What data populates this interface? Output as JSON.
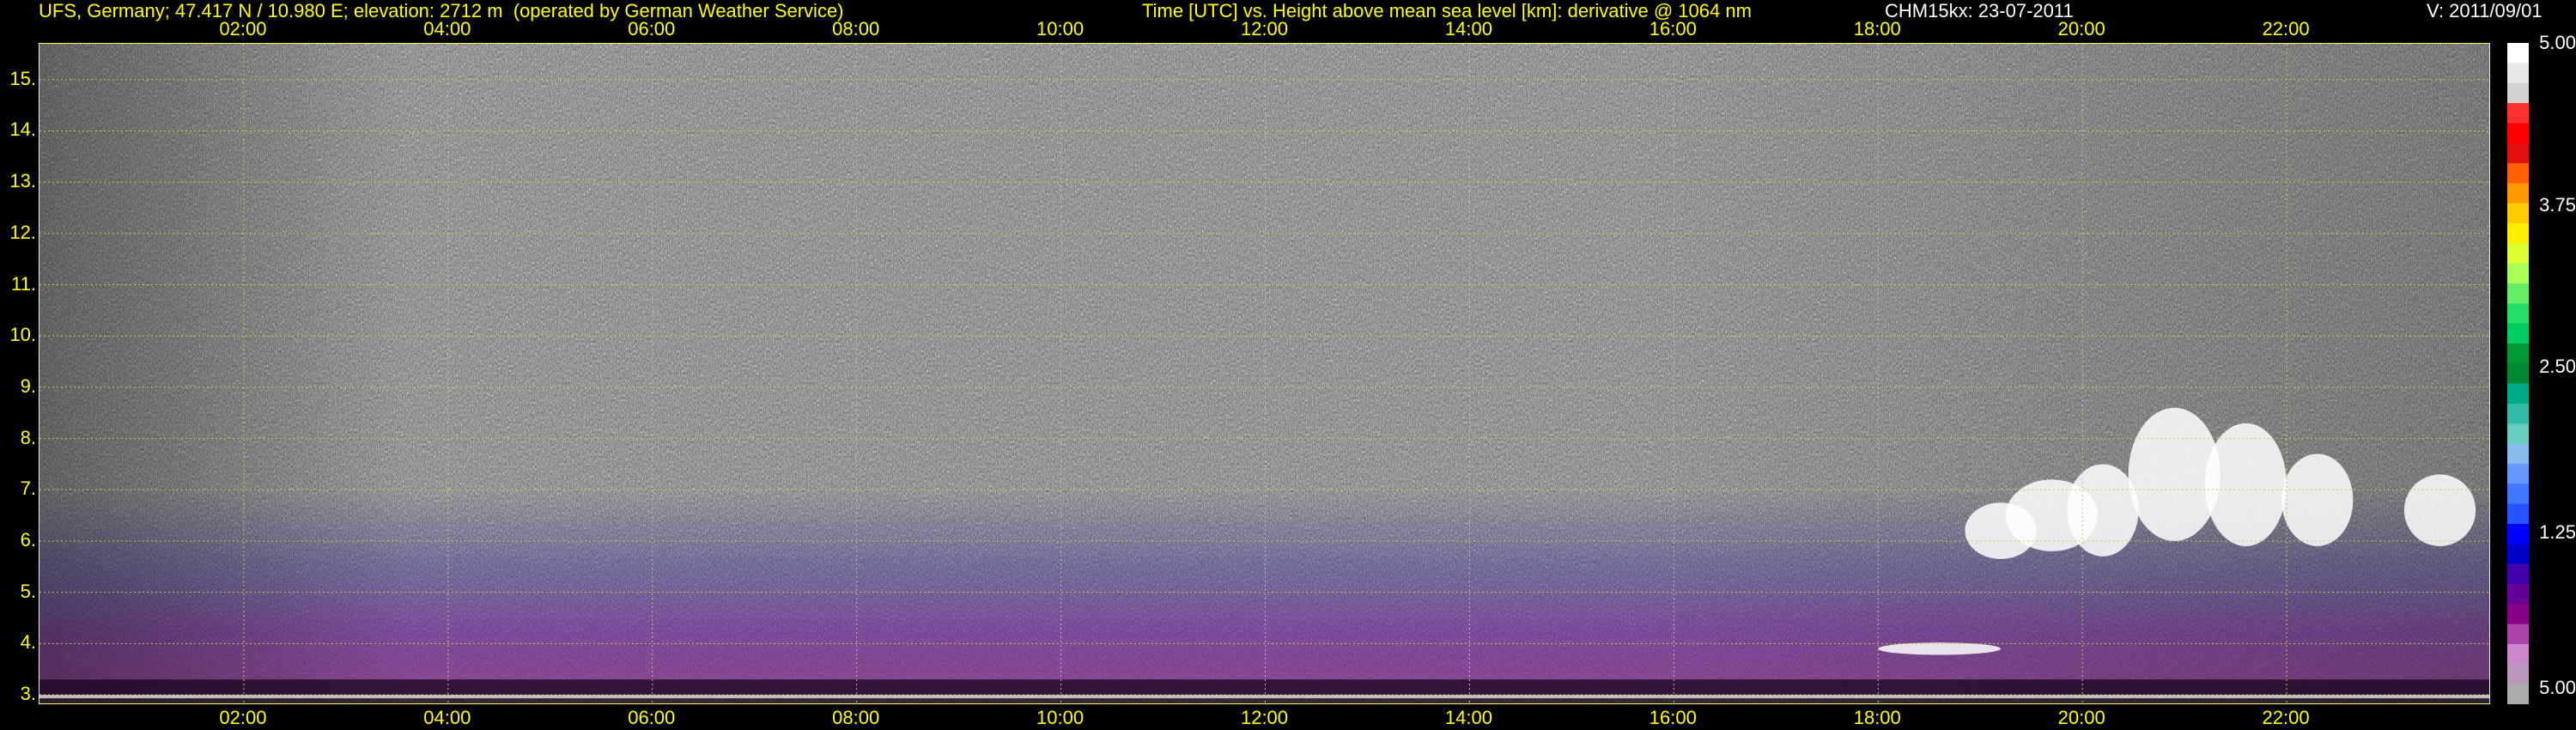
{
  "header": {
    "site": "UFS, Germany; 47.417 N / 10.980 E; elevation: 2712 m  (operated by German Weather Service)",
    "description": "Time [UTC] vs. Height above mean sea level [km]: derivative @ 1064 nm",
    "instrument": "CHM15kx: 23-07-2011",
    "version": "V: 2011/09/01"
  },
  "chart_data": {
    "type": "heatmap",
    "title": "Time [UTC] vs. Height above mean sea level [km]: derivative @ 1064 nm",
    "xlabel": "Time [UTC]",
    "ylabel": "Height above mean sea level [km]",
    "x_unit_range_hours": [
      0,
      24
    ],
    "x_tick_labels": [
      "02:00",
      "04:00",
      "06:00",
      "08:00",
      "10:00",
      "12:00",
      "14:00",
      "16:00",
      "18:00",
      "20:00",
      "22:00"
    ],
    "x_tick_hours": [
      2,
      4,
      6,
      8,
      10,
      12,
      14,
      16,
      18,
      20,
      22
    ],
    "ylim_km": [
      2.8,
      15.7
    ],
    "y_tick_labels": [
      "3.",
      "4.",
      "5.",
      "6.",
      "7.",
      "8.",
      "9.",
      "10.",
      "11.",
      "12.",
      "13.",
      "14.",
      "15."
    ],
    "y_tick_values": [
      3,
      4,
      5,
      6,
      7,
      8,
      9,
      10,
      11,
      12,
      13,
      14,
      15
    ],
    "grid": true,
    "grid_color": "#cccc33",
    "colorbar": {
      "labels": [
        "5.00",
        "3.75",
        "2.50",
        "1.25",
        "5.00"
      ],
      "label_values": [
        5.0,
        3.75,
        2.5,
        1.25,
        5.0
      ],
      "colors_top_to_bottom": [
        "#ffffff",
        "#e8e8e8",
        "#d0d0d0",
        "#ff3030",
        "#ff0000",
        "#e01010",
        "#ff6000",
        "#ff9900",
        "#ffcc00",
        "#ffee00",
        "#ddff33",
        "#aaff55",
        "#66ee66",
        "#22dd66",
        "#00cc66",
        "#009933",
        "#008833",
        "#00aa88",
        "#33bbaa",
        "#66ccbb",
        "#88bbee",
        "#6699ff",
        "#4477ff",
        "#2255ff",
        "#0000ff",
        "#0000cc",
        "#4400aa",
        "#660099",
        "#880088",
        "#aa44aa",
        "#cc88cc",
        "#bb99bb",
        "#aaaaaa"
      ]
    },
    "features": [
      {
        "name": "noise_background",
        "height_km": [
          6.0,
          15.7
        ],
        "hours": [
          0,
          24
        ]
      },
      {
        "name": "aerosol_layer",
        "height_km": [
          3.0,
          7.0
        ],
        "hours": [
          0,
          24
        ]
      },
      {
        "name": "cloud",
        "height_km": [
          5.3,
          8.8
        ],
        "hours": [
          18.9,
          23.9
        ]
      }
    ]
  }
}
